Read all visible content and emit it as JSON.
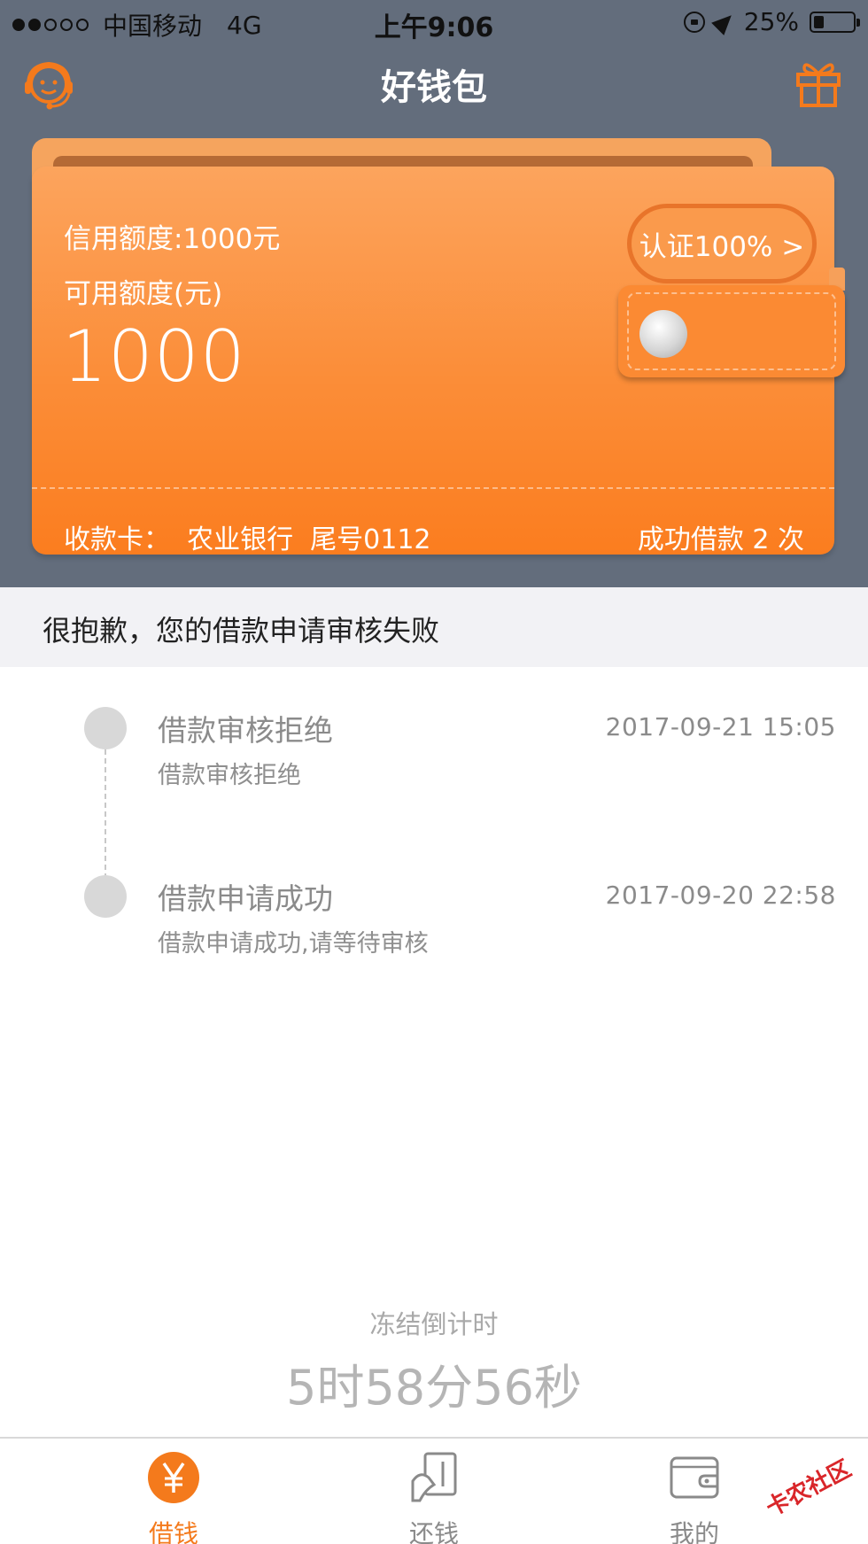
{
  "status_bar": {
    "carrier": "中国移动",
    "network": "4G",
    "time": "上午9:06",
    "battery": "25%",
    "battery_level": 0.25
  },
  "nav": {
    "title": "好钱包",
    "left_icon": "headset-service-icon",
    "right_icon": "gift-icon"
  },
  "wallet": {
    "credit_label": "信用额度:1000元",
    "available_label": "可用额度(元)",
    "available_value": "1000",
    "certify_button": "认证100% >",
    "receive_card": "收款卡：  农业银行  尾号0112",
    "loan_count": "成功借款 2 次"
  },
  "notice": {
    "text": "很抱歉，您的借款申请审核失败"
  },
  "timeline": [
    {
      "title": "借款审核拒绝",
      "desc": "借款审核拒绝",
      "time": "2017-09-21 15:05"
    },
    {
      "title": "借款申请成功",
      "desc": "借款申请成功,请等待审核",
      "time": "2017-09-20 22:58"
    }
  ],
  "countdown": {
    "label": "冻结倒计时",
    "value": "5时58分56秒"
  },
  "tabs": [
    {
      "label": "借钱",
      "icon": "yen-icon",
      "active": true
    },
    {
      "label": "还钱",
      "icon": "repay-card-icon",
      "active": false
    },
    {
      "label": "我的",
      "icon": "wallet-icon",
      "active": false
    }
  ],
  "watermark": "卡农社区",
  "colors": {
    "header_bg": "#636d7c",
    "accent": "#f47a1c",
    "wallet_orange": "#fb8d38"
  }
}
